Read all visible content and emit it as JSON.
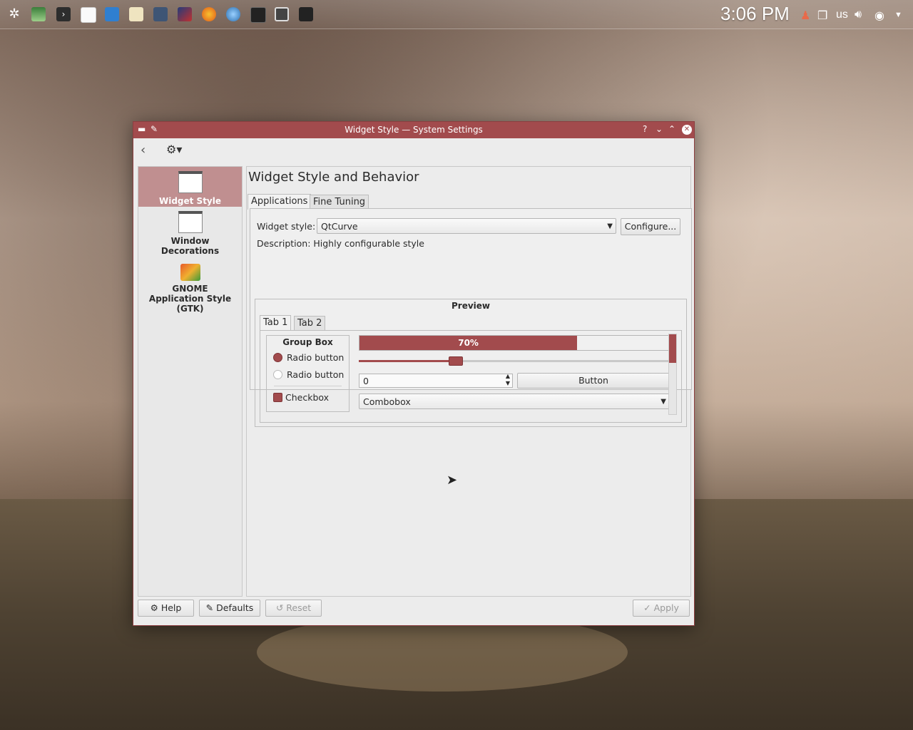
{
  "taskbar": {
    "clock": "3:06 PM",
    "keyboard_layout": "us",
    "icons": [
      "kde-launcher-icon",
      "system-monitor-icon",
      "terminal-icon",
      "text-editor-icon",
      "mail-icon",
      "notes-icon",
      "file-manager-icon",
      "kdevelop-icon",
      "firefox-icon",
      "network-icon",
      "media-player-icon",
      "display-icon",
      "battery-icon"
    ]
  },
  "window": {
    "title": "Widget Style  — System Settings",
    "controls": {
      "help": "?",
      "minimize": "⌄",
      "maximize": "⌃",
      "close": "✕"
    }
  },
  "sidebar": {
    "items": [
      {
        "label": "Widget Style",
        "active": true
      },
      {
        "label": "Window Decorations",
        "active": false
      },
      {
        "label": "GNOME Application Style (GTK)",
        "active": false
      }
    ]
  },
  "content": {
    "heading": "Widget Style and Behavior",
    "tabs": [
      "Applications",
      "Fine Tuning"
    ],
    "widget_style_label": "Widget style:",
    "widget_style_value": "QtCurve",
    "configure_button": "Configure...",
    "description": "Description: Highly configurable style",
    "preview": {
      "title": "Preview",
      "tabs": [
        "Tab 1",
        "Tab 2"
      ],
      "group_box_title": "Group Box",
      "radio1": "Radio button",
      "radio2": "Radio button",
      "checkbox": "Checkbox",
      "progress": 70,
      "progress_label": "70%",
      "slider_value": 0.31,
      "spin_value": "0",
      "button": "Button",
      "combobox": "Combobox"
    }
  },
  "footer": {
    "help": "Help",
    "defaults": "Defaults",
    "reset": "Reset",
    "apply": "Apply"
  },
  "colors": {
    "accent": "#a24b4d",
    "accent_light": "#c08f90",
    "window_bg": "#ececec"
  }
}
